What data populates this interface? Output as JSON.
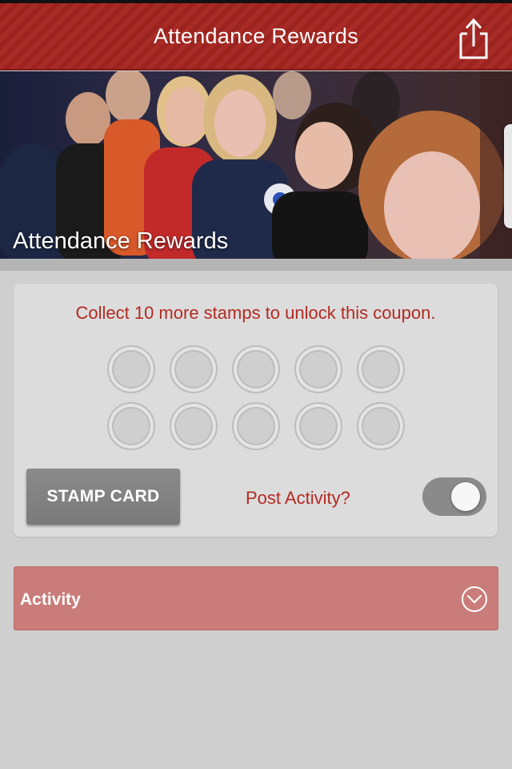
{
  "header": {
    "title": "Attendance Rewards",
    "share_icon": "share-icon"
  },
  "hero": {
    "title": "Attendance Rewards"
  },
  "stamp_card": {
    "message": "Collect 10 more stamps to unlock this coupon.",
    "stamps_total": 10,
    "stamps_collected": 0,
    "button_label": "STAMP CARD",
    "post_activity_label": "Post Activity?",
    "post_activity_toggle_on": true
  },
  "activity": {
    "label": "Activity",
    "expand_icon": "chevron-down-circle-icon"
  },
  "colors": {
    "brand_red": "#9c2420",
    "text_red": "#b32a22",
    "activity_bar": "#c97c79",
    "button_gray": "#808080"
  }
}
